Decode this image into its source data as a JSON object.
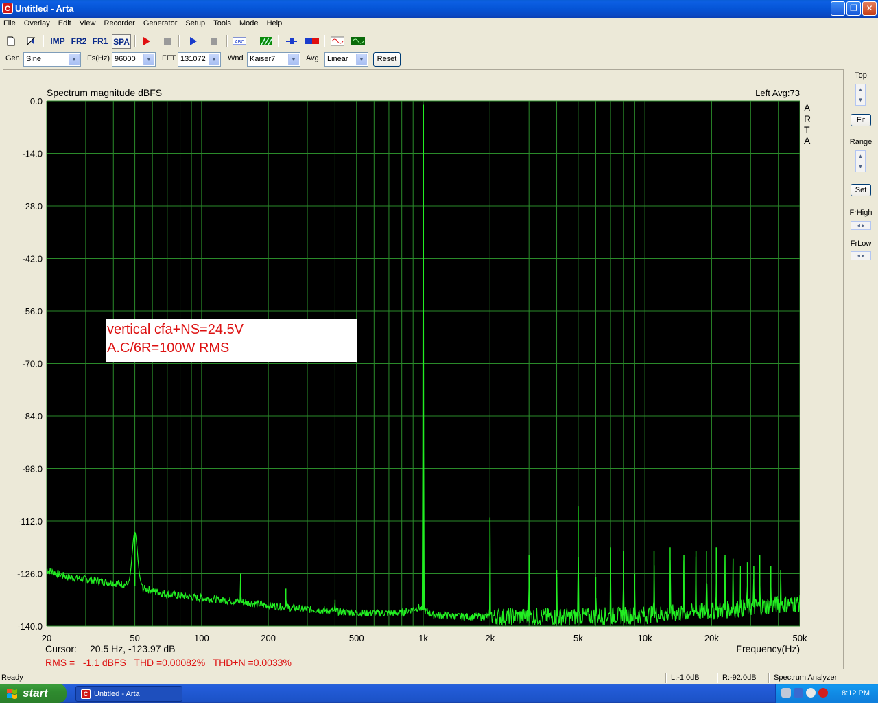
{
  "window": {
    "title": "Untitled - Arta",
    "icon": "arta-app-icon"
  },
  "menu": [
    "File",
    "Overlay",
    "Edit",
    "View",
    "Recorder",
    "Generator",
    "Setup",
    "Tools",
    "Mode",
    "Help"
  ],
  "toolbar": {
    "imp": "IMP",
    "fr2": "FR2",
    "fr1": "FR1",
    "spa": "SPA"
  },
  "controls": {
    "gen_label": "Gen",
    "gen_value": "Sine",
    "fs_label": "Fs(Hz)",
    "fs_value": "96000",
    "fft_label": "FFT",
    "fft_value": "131072",
    "wnd_label": "Wnd",
    "wnd_value": "Kaiser7",
    "avg_label": "Avg",
    "avg_value": "Linear",
    "reset": "Reset"
  },
  "right_panel": {
    "top": "Top",
    "fit": "Fit",
    "range": "Range",
    "set": "Set",
    "frhigh": "FrHigh",
    "frlow": "FrLow"
  },
  "plot": {
    "title": "Spectrum magnitude dBFS",
    "channel_info": "Left  Avg:73",
    "watermark": [
      "A",
      "R",
      "T",
      "A"
    ],
    "annotation_line1": "vertical cfa+NS=24.5V",
    "annotation_line2": "A.C/6R=100W RMS",
    "cursor_label": "Cursor:",
    "cursor_value": "20.5 Hz, -123.97 dB",
    "xlabel": "Frequency(Hz)",
    "stats": "RMS =   -1.1 dBFS   THD =0.00082%   THD+N =0.0033%"
  },
  "status": {
    "ready": "Ready",
    "left_level": "L:-1.0dB",
    "right_level": "R:-92.0dB",
    "mode": "Spectrum Analyzer"
  },
  "taskbar": {
    "start": "start",
    "task": "Untitled - Arta",
    "clock": "8:12 PM"
  },
  "colors": {
    "trace": "#22ee22",
    "grid": "#2a8a2a",
    "plot_bg": "#000000",
    "annotation_text": "#dd1111"
  },
  "chart_data": {
    "type": "line",
    "title": "Spectrum magnitude dBFS",
    "xlabel": "Frequency(Hz)",
    "ylabel": "",
    "x_scale": "log",
    "xlim": [
      20,
      50000
    ],
    "ylim": [
      -140,
      0
    ],
    "x_ticks": [
      {
        "v": 20,
        "label": "20"
      },
      {
        "v": 50,
        "label": "50"
      },
      {
        "v": 100,
        "label": "100"
      },
      {
        "v": 200,
        "label": "200"
      },
      {
        "v": 500,
        "label": "500"
      },
      {
        "v": 1000,
        "label": "1k"
      },
      {
        "v": 2000,
        "label": "2k"
      },
      {
        "v": 5000,
        "label": "5k"
      },
      {
        "v": 10000,
        "label": "10k"
      },
      {
        "v": 20000,
        "label": "20k"
      },
      {
        "v": 50000,
        "label": "50k"
      }
    ],
    "y_ticks": [
      "0.0",
      "-14.0",
      "-28.0",
      "-42.0",
      "-56.0",
      "-70.0",
      "-84.0",
      "-98.0",
      "-112.0",
      "-126.0",
      "-140.0"
    ],
    "grid": true,
    "noise_floor": [
      [
        20,
        -125
      ],
      [
        25,
        -127
      ],
      [
        30,
        -127.5
      ],
      [
        40,
        -128.5
      ],
      [
        48,
        -129
      ],
      [
        55,
        -130
      ],
      [
        70,
        -131.5
      ],
      [
        100,
        -132.5
      ],
      [
        150,
        -133.5
      ],
      [
        200,
        -134.5
      ],
      [
        300,
        -135.5
      ],
      [
        500,
        -136.5
      ],
      [
        800,
        -136.5
      ],
      [
        950,
        -135
      ],
      [
        1100,
        -137
      ],
      [
        1500,
        -137.5
      ],
      [
        2000,
        -137.5
      ],
      [
        5000,
        -137.5
      ],
      [
        10000,
        -137
      ],
      [
        20000,
        -136
      ],
      [
        30000,
        -135
      ],
      [
        45000,
        -134
      ]
    ],
    "peaks": [
      {
        "f": 50,
        "db": -115
      },
      {
        "f": 150,
        "db": -126
      },
      {
        "f": 240,
        "db": -130
      },
      {
        "f": 400,
        "db": -133
      },
      {
        "f": 1000,
        "db": -1
      },
      {
        "f": 2000,
        "db": -111
      },
      {
        "f": 3000,
        "db": -121
      },
      {
        "f": 4000,
        "db": -125
      },
      {
        "f": 5000,
        "db": -108
      },
      {
        "f": 6000,
        "db": -127
      },
      {
        "f": 7000,
        "db": -119
      },
      {
        "f": 8000,
        "db": -120
      },
      {
        "f": 9000,
        "db": -126
      },
      {
        "f": 11000,
        "db": -120
      },
      {
        "f": 13000,
        "db": -119
      },
      {
        "f": 15000,
        "db": -121
      },
      {
        "f": 17000,
        "db": -120
      },
      {
        "f": 19000,
        "db": -120
      },
      {
        "f": 21000,
        "db": -119
      },
      {
        "f": 23000,
        "db": -121
      },
      {
        "f": 25000,
        "db": -122
      },
      {
        "f": 27000,
        "db": -124
      },
      {
        "f": 29000,
        "db": -123
      },
      {
        "f": 31000,
        "db": -124
      },
      {
        "f": 33000,
        "db": -121
      },
      {
        "f": 37000,
        "db": -124
      },
      {
        "f": 41000,
        "db": -125
      }
    ]
  }
}
